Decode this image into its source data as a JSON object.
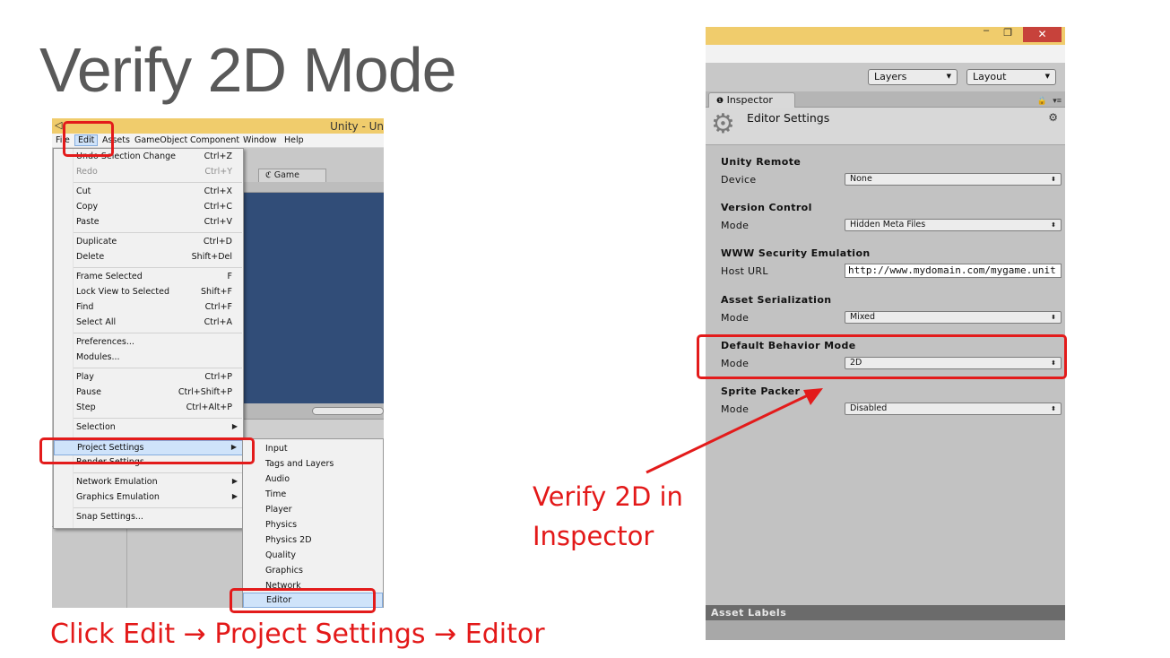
{
  "slide": {
    "title": "Verify 2D Mode",
    "caption_left": "Click Edit → Project Settings → Editor",
    "caption_right": "Verify 2D in Inspector"
  },
  "unity": {
    "window_title": "Unity - Un",
    "menubar": [
      "File",
      "Edit",
      "Assets",
      "GameObject",
      "Component",
      "Window",
      "Help"
    ],
    "game_tab": "Game",
    "edit_menu": [
      {
        "label": "Undo Selection Change",
        "shortcut": "Ctrl+Z"
      },
      {
        "label": "Redo",
        "shortcut": "Ctrl+Y",
        "disabled": true
      },
      {
        "label": "Cut",
        "shortcut": "Ctrl+X"
      },
      {
        "label": "Copy",
        "shortcut": "Ctrl+C"
      },
      {
        "label": "Paste",
        "shortcut": "Ctrl+V"
      },
      {
        "label": "Duplicate",
        "shortcut": "Ctrl+D"
      },
      {
        "label": "Delete",
        "shortcut": "Shift+Del"
      },
      {
        "label": "Frame Selected",
        "shortcut": "F"
      },
      {
        "label": "Lock View to Selected",
        "shortcut": "Shift+F"
      },
      {
        "label": "Find",
        "shortcut": "Ctrl+F"
      },
      {
        "label": "Select All",
        "shortcut": "Ctrl+A"
      },
      {
        "label": "Preferences...",
        "shortcut": ""
      },
      {
        "label": "Modules...",
        "shortcut": ""
      },
      {
        "label": "Play",
        "shortcut": "Ctrl+P"
      },
      {
        "label": "Pause",
        "shortcut": "Ctrl+Shift+P"
      },
      {
        "label": "Step",
        "shortcut": "Ctrl+Alt+P"
      },
      {
        "label": "Selection",
        "shortcut": ""
      },
      {
        "label": "Project Settings",
        "shortcut": ""
      },
      {
        "label": "Render Settings",
        "shortcut": ""
      },
      {
        "label": "Network Emulation",
        "shortcut": ""
      },
      {
        "label": "Graphics Emulation",
        "shortcut": ""
      },
      {
        "label": "Snap Settings...",
        "shortcut": ""
      }
    ],
    "submenu": [
      "Input",
      "Tags and Layers",
      "Audio",
      "Time",
      "Player",
      "Physics",
      "Physics 2D",
      "Quality",
      "Graphics",
      "Network",
      "Editor"
    ]
  },
  "inspector": {
    "layers_label": "Layers",
    "layout_label": "Layout",
    "tab_label": "Inspector",
    "header_title": "Editor Settings",
    "sections": [
      {
        "title": "Unity Remote",
        "label": "Device",
        "value": "None"
      },
      {
        "title": "Version Control",
        "label": "Mode",
        "value": "Hidden Meta Files"
      },
      {
        "title": "WWW Security Emulation",
        "label": "Host URL",
        "value": "http://www.mydomain.com/mygame.unit"
      },
      {
        "title": "Asset Serialization",
        "label": "Mode",
        "value": "Mixed"
      },
      {
        "title": "Default Behavior Mode",
        "label": "Mode",
        "value": "2D"
      },
      {
        "title": "Sprite Packer",
        "label": "Mode",
        "value": "Disabled"
      }
    ],
    "asset_labels": "Asset Labels"
  },
  "colors": {
    "highlight_red": "#e31b1b",
    "unity_titlebar": "#f0cc6c",
    "game_view": "#314d78"
  }
}
